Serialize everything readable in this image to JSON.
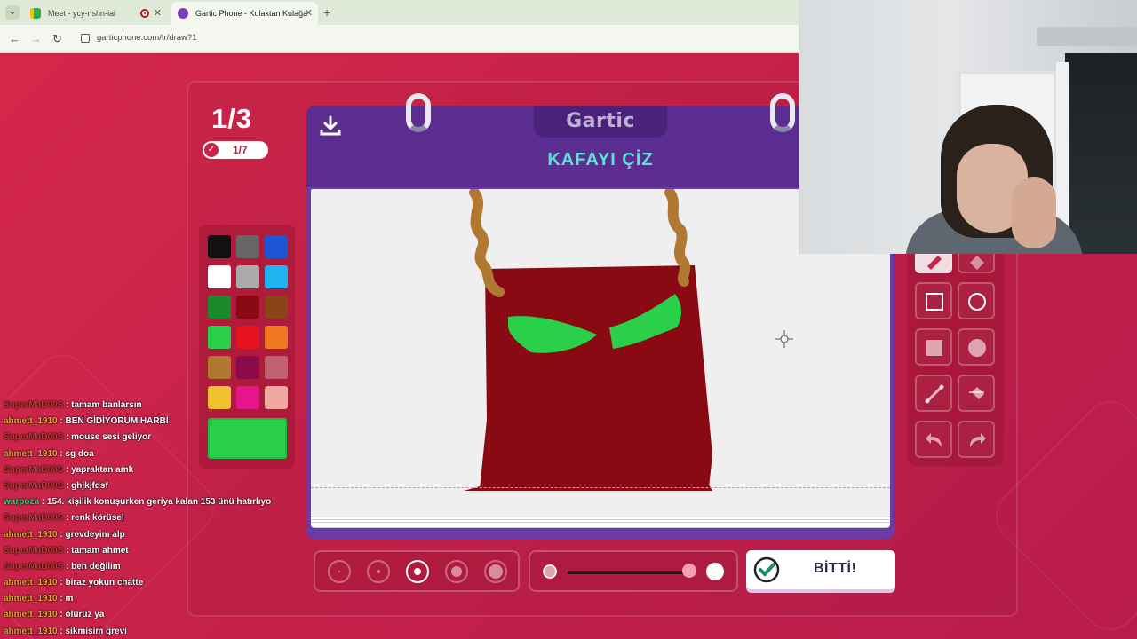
{
  "browser": {
    "tabs": [
      {
        "title": "Meet - ycy-nshn-iai",
        "active": false
      },
      {
        "title": "Gartic Phone - Kulaktan Kulağa",
        "active": true
      }
    ],
    "url": "garticphone.com/tr/draw?1"
  },
  "game": {
    "logo": "Gartic",
    "round": "1/3",
    "players_done": "1/7",
    "prompt": "KAFAYI ÇİZ",
    "done_button": "BİTTİ!",
    "palette": [
      "#111111",
      "#666666",
      "#1a56d6",
      "#ffffff",
      "#aaaaaa",
      "#1fb3f0",
      "#1a8a2a",
      "#8a0a14",
      "#8a4418",
      "#2ad04a",
      "#e6141e",
      "#f07820",
      "#b07830",
      "#8a0a4a",
      "#c06070",
      "#f0c030",
      "#e8148c",
      "#f0a8a0"
    ],
    "selected_color": "#2ad04a",
    "brush_sizes": [
      1,
      2,
      3,
      4,
      5
    ],
    "selected_brush": 3,
    "opacity": 0.95
  },
  "chat": [
    {
      "user": "SuperMaD00S",
      "color": "#c0392b",
      "message": ": tamam banlarsın"
    },
    {
      "user": "ahmett_1910",
      "color": "#e8a23a",
      "message": ": BEN GİDİYORUM HARBİ"
    },
    {
      "user": "SuperMaD00S",
      "color": "#c0392b",
      "message": ": mouse sesi geliyor"
    },
    {
      "user": "ahmett_1910",
      "color": "#e8a23a",
      "message": ": sg doa"
    },
    {
      "user": "SuperMaD00S",
      "color": "#c0392b",
      "message": ": yapraktan amk"
    },
    {
      "user": "SuperMaD00S",
      "color": "#c0392b",
      "message": ": ghjkjfdsf"
    },
    {
      "user": "warpoza",
      "color": "#3ad07a",
      "message": ": 154. kişilik konuşurken geriya kalan 153 ünü hatırlıyo"
    },
    {
      "user": "SuperMaD00S",
      "color": "#c0392b",
      "message": ": renk körüsel"
    },
    {
      "user": "ahmett_1910",
      "color": "#e8a23a",
      "message": ": grevdeyim alp"
    },
    {
      "user": "SuperMaD00S",
      "color": "#c0392b",
      "message": ": tamam ahmet"
    },
    {
      "user": "SuperMaD00S",
      "color": "#c0392b",
      "message": ": ben değilim"
    },
    {
      "user": "ahmett_1910",
      "color": "#e8a23a",
      "message": ": biraz yokun chatte"
    },
    {
      "user": "ahmett_1910",
      "color": "#e8a23a",
      "message": ": m"
    },
    {
      "user": "ahmett_1910",
      "color": "#e8a23a",
      "message": ": ölürüz ya"
    },
    {
      "user": "ahmett_1910",
      "color": "#e8a23a",
      "message": ": sikmisim grevi"
    }
  ]
}
